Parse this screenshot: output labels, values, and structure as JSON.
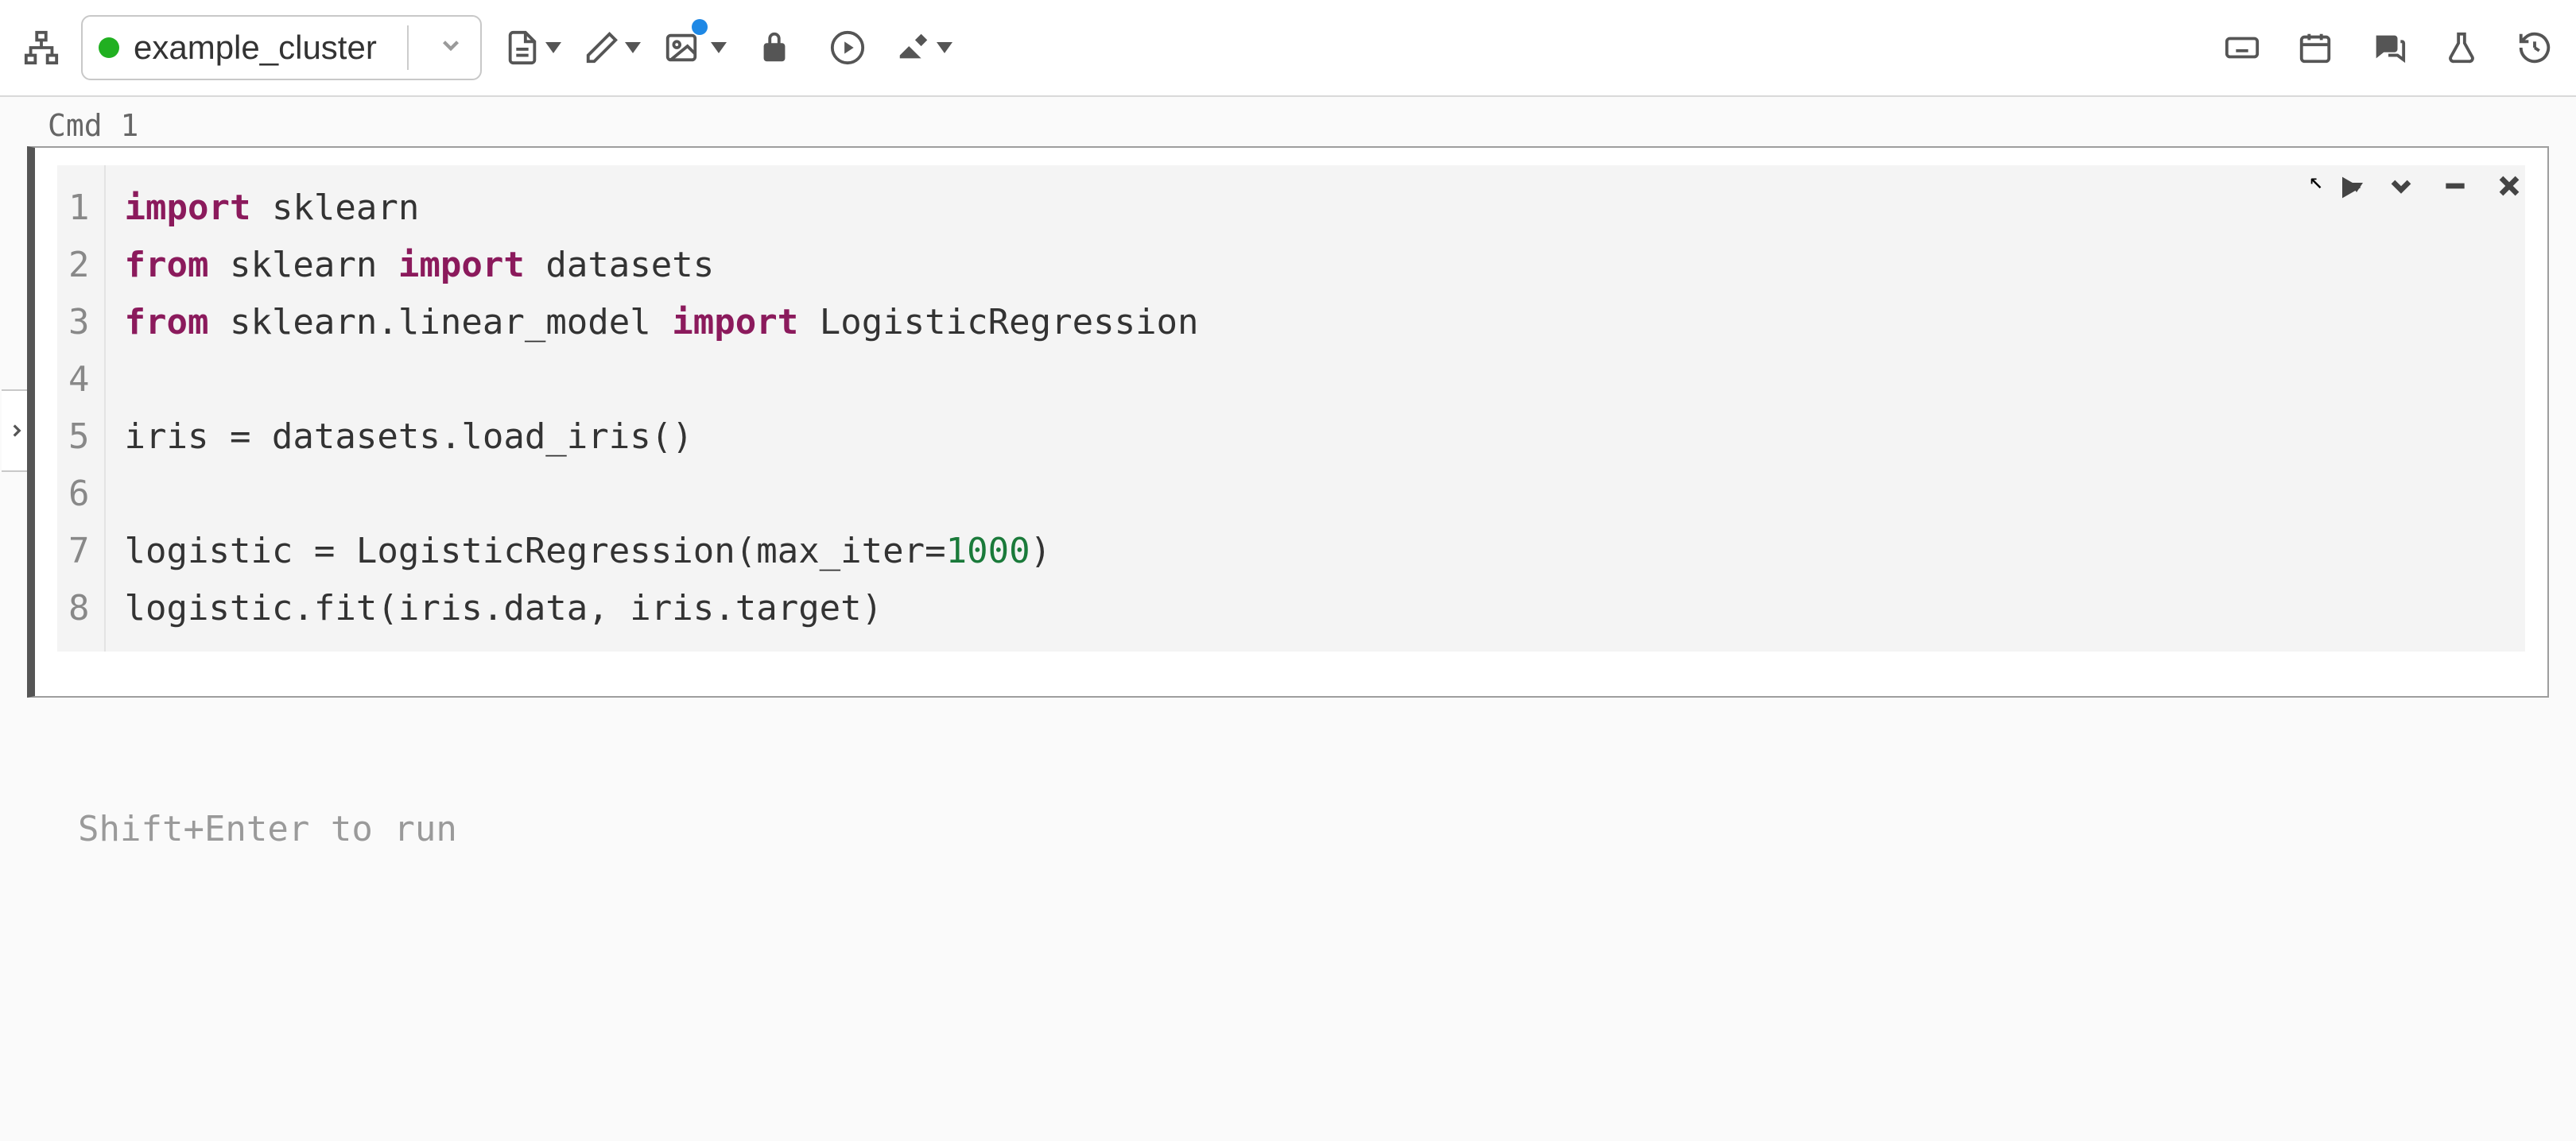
{
  "toolbar": {
    "cluster_name": "example_cluster",
    "cluster_status": "running",
    "status_color": "#21b021"
  },
  "cell": {
    "label": "Cmd 1",
    "code_lines": [
      [
        {
          "t": "import",
          "c": "kw"
        },
        {
          "t": " sklearn",
          "c": ""
        }
      ],
      [
        {
          "t": "from",
          "c": "kw"
        },
        {
          "t": " sklearn ",
          "c": ""
        },
        {
          "t": "import",
          "c": "kw"
        },
        {
          "t": " datasets",
          "c": ""
        }
      ],
      [
        {
          "t": "from",
          "c": "kw"
        },
        {
          "t": " sklearn.linear_model ",
          "c": ""
        },
        {
          "t": "import",
          "c": "kw"
        },
        {
          "t": " LogisticRegression",
          "c": ""
        }
      ],
      [
        {
          "t": "",
          "c": ""
        }
      ],
      [
        {
          "t": "iris = datasets.load_iris()",
          "c": ""
        }
      ],
      [
        {
          "t": "",
          "c": ""
        }
      ],
      [
        {
          "t": "logistic = LogisticRegression(max_iter=",
          "c": ""
        },
        {
          "t": "1000",
          "c": "num"
        },
        {
          "t": ")",
          "c": ""
        }
      ],
      [
        {
          "t": "logistic.fit(iris.data, iris.target)",
          "c": ""
        }
      ]
    ]
  },
  "hint": "Shift+Enter to run"
}
